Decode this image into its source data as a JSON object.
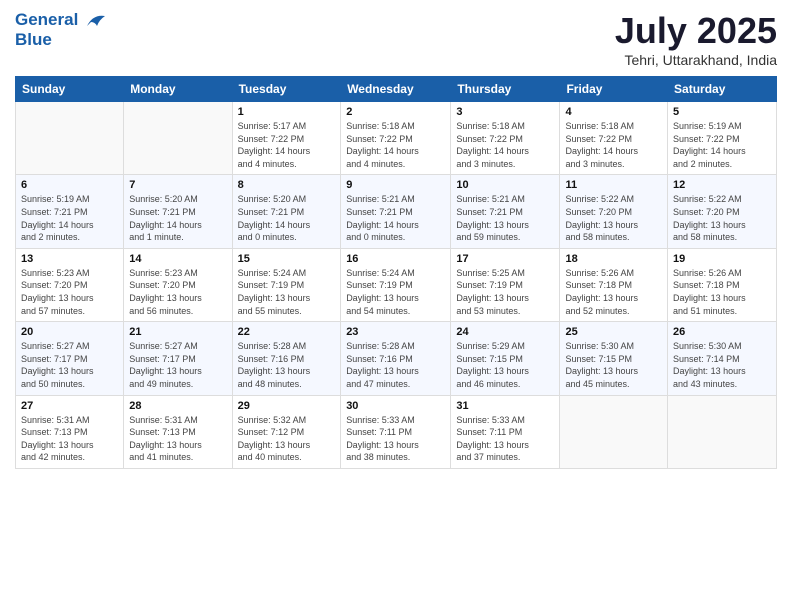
{
  "logo": {
    "line1": "General",
    "line2": "Blue"
  },
  "title": "July 2025",
  "subtitle": "Tehri, Uttarakhand, India",
  "weekdays": [
    "Sunday",
    "Monday",
    "Tuesday",
    "Wednesday",
    "Thursday",
    "Friday",
    "Saturday"
  ],
  "weeks": [
    [
      {
        "day": "",
        "info": ""
      },
      {
        "day": "",
        "info": ""
      },
      {
        "day": "1",
        "info": "Sunrise: 5:17 AM\nSunset: 7:22 PM\nDaylight: 14 hours\nand 4 minutes."
      },
      {
        "day": "2",
        "info": "Sunrise: 5:18 AM\nSunset: 7:22 PM\nDaylight: 14 hours\nand 4 minutes."
      },
      {
        "day": "3",
        "info": "Sunrise: 5:18 AM\nSunset: 7:22 PM\nDaylight: 14 hours\nand 3 minutes."
      },
      {
        "day": "4",
        "info": "Sunrise: 5:18 AM\nSunset: 7:22 PM\nDaylight: 14 hours\nand 3 minutes."
      },
      {
        "day": "5",
        "info": "Sunrise: 5:19 AM\nSunset: 7:22 PM\nDaylight: 14 hours\nand 2 minutes."
      }
    ],
    [
      {
        "day": "6",
        "info": "Sunrise: 5:19 AM\nSunset: 7:21 PM\nDaylight: 14 hours\nand 2 minutes."
      },
      {
        "day": "7",
        "info": "Sunrise: 5:20 AM\nSunset: 7:21 PM\nDaylight: 14 hours\nand 1 minute."
      },
      {
        "day": "8",
        "info": "Sunrise: 5:20 AM\nSunset: 7:21 PM\nDaylight: 14 hours\nand 0 minutes."
      },
      {
        "day": "9",
        "info": "Sunrise: 5:21 AM\nSunset: 7:21 PM\nDaylight: 14 hours\nand 0 minutes."
      },
      {
        "day": "10",
        "info": "Sunrise: 5:21 AM\nSunset: 7:21 PM\nDaylight: 13 hours\nand 59 minutes."
      },
      {
        "day": "11",
        "info": "Sunrise: 5:22 AM\nSunset: 7:20 PM\nDaylight: 13 hours\nand 58 minutes."
      },
      {
        "day": "12",
        "info": "Sunrise: 5:22 AM\nSunset: 7:20 PM\nDaylight: 13 hours\nand 58 minutes."
      }
    ],
    [
      {
        "day": "13",
        "info": "Sunrise: 5:23 AM\nSunset: 7:20 PM\nDaylight: 13 hours\nand 57 minutes."
      },
      {
        "day": "14",
        "info": "Sunrise: 5:23 AM\nSunset: 7:20 PM\nDaylight: 13 hours\nand 56 minutes."
      },
      {
        "day": "15",
        "info": "Sunrise: 5:24 AM\nSunset: 7:19 PM\nDaylight: 13 hours\nand 55 minutes."
      },
      {
        "day": "16",
        "info": "Sunrise: 5:24 AM\nSunset: 7:19 PM\nDaylight: 13 hours\nand 54 minutes."
      },
      {
        "day": "17",
        "info": "Sunrise: 5:25 AM\nSunset: 7:19 PM\nDaylight: 13 hours\nand 53 minutes."
      },
      {
        "day": "18",
        "info": "Sunrise: 5:26 AM\nSunset: 7:18 PM\nDaylight: 13 hours\nand 52 minutes."
      },
      {
        "day": "19",
        "info": "Sunrise: 5:26 AM\nSunset: 7:18 PM\nDaylight: 13 hours\nand 51 minutes."
      }
    ],
    [
      {
        "day": "20",
        "info": "Sunrise: 5:27 AM\nSunset: 7:17 PM\nDaylight: 13 hours\nand 50 minutes."
      },
      {
        "day": "21",
        "info": "Sunrise: 5:27 AM\nSunset: 7:17 PM\nDaylight: 13 hours\nand 49 minutes."
      },
      {
        "day": "22",
        "info": "Sunrise: 5:28 AM\nSunset: 7:16 PM\nDaylight: 13 hours\nand 48 minutes."
      },
      {
        "day": "23",
        "info": "Sunrise: 5:28 AM\nSunset: 7:16 PM\nDaylight: 13 hours\nand 47 minutes."
      },
      {
        "day": "24",
        "info": "Sunrise: 5:29 AM\nSunset: 7:15 PM\nDaylight: 13 hours\nand 46 minutes."
      },
      {
        "day": "25",
        "info": "Sunrise: 5:30 AM\nSunset: 7:15 PM\nDaylight: 13 hours\nand 45 minutes."
      },
      {
        "day": "26",
        "info": "Sunrise: 5:30 AM\nSunset: 7:14 PM\nDaylight: 13 hours\nand 43 minutes."
      }
    ],
    [
      {
        "day": "27",
        "info": "Sunrise: 5:31 AM\nSunset: 7:13 PM\nDaylight: 13 hours\nand 42 minutes."
      },
      {
        "day": "28",
        "info": "Sunrise: 5:31 AM\nSunset: 7:13 PM\nDaylight: 13 hours\nand 41 minutes."
      },
      {
        "day": "29",
        "info": "Sunrise: 5:32 AM\nSunset: 7:12 PM\nDaylight: 13 hours\nand 40 minutes."
      },
      {
        "day": "30",
        "info": "Sunrise: 5:33 AM\nSunset: 7:11 PM\nDaylight: 13 hours\nand 38 minutes."
      },
      {
        "day": "31",
        "info": "Sunrise: 5:33 AM\nSunset: 7:11 PM\nDaylight: 13 hours\nand 37 minutes."
      },
      {
        "day": "",
        "info": ""
      },
      {
        "day": "",
        "info": ""
      }
    ]
  ]
}
